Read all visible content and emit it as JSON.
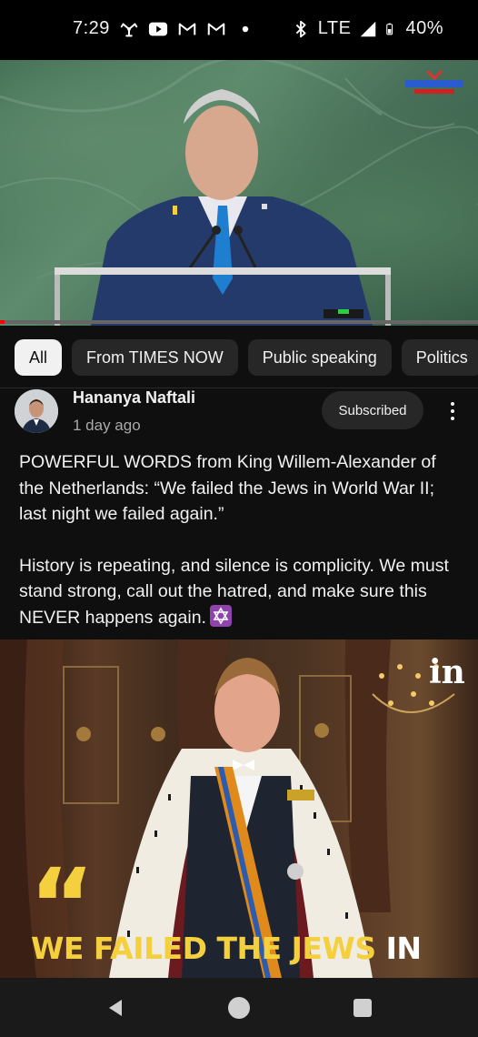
{
  "status_bar": {
    "time": "7:29",
    "network": "LTE",
    "battery": "40%",
    "icons": [
      "fan-icon",
      "youtube-icon",
      "gmail-icon",
      "gmail-icon",
      "dot-icon",
      "bluetooth-icon",
      "signal-icon",
      "battery-icon"
    ]
  },
  "video": {
    "progress_percent": 1,
    "progress_color": "#ff0000"
  },
  "chips": [
    {
      "label": "All",
      "active": true
    },
    {
      "label": "From TIMES NOW",
      "active": false
    },
    {
      "label": "Public speaking",
      "active": false
    },
    {
      "label": "Politics",
      "active": false
    }
  ],
  "post": {
    "author": "Hananya Naftali",
    "time": "1 day ago",
    "subscribe_label": "Subscribed",
    "paragraph_1": "POWERFUL WORDS from King Willem-Alexander of the Netherlands: “We failed the Jews in World War II; last night we failed again.”",
    "paragraph_2": "History is repeating, and silence is complicity. We must stand strong, call out the hatred, and make sure this NEVER happens again.",
    "image_caption_yellow": "WE FAILED THE JEWS",
    "image_caption_white": "IN",
    "image_quote_mark": "“",
    "image_brand": "in"
  },
  "colors": {
    "background": "#0f0f0f",
    "chip_bg": "#272727",
    "accent_yellow": "#f4d03f",
    "secondary_text": "#aaaaaa"
  }
}
